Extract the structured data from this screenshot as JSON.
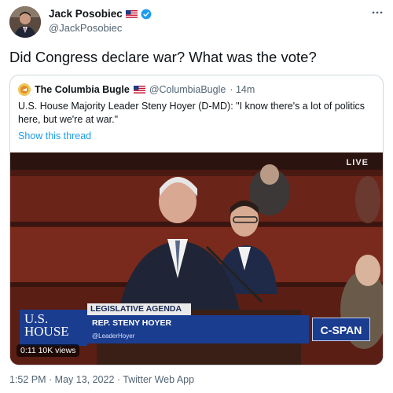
{
  "tweet": {
    "author_name": "Jack Posobiec",
    "author_handle": "@JackPosobiec",
    "more_icon": "more-icon",
    "text": "Did Congress declare war? What was the vote?",
    "timestamp": "1:52 PM · May 13, 2022 · Twitter Web App"
  },
  "quoted": {
    "name": "The Columbia Bugle",
    "handle": "@ColumbiaBugle",
    "time": "· 14m",
    "text": "U.S. House Majority Leader Steny Hoyer (D-MD): \"I know there's a lot of politics here, but we're at war.\"",
    "show_thread": "Show this thread",
    "video": {
      "live": "LIVE",
      "banner_top": "LEGISLATIVE AGENDA",
      "banner_name": "REP. STENY HOYER",
      "banner_handle": "@LeaderHoyer",
      "house_logo": "U.S. HOUSE",
      "cspan": "C-SPAN",
      "time_views": "0:11  10K views"
    }
  },
  "colors": {
    "link": "#1d9bf0",
    "secondary_text": "#536471",
    "verified": "#1d9bf0",
    "cspan_blue": "#1b3d8f"
  }
}
